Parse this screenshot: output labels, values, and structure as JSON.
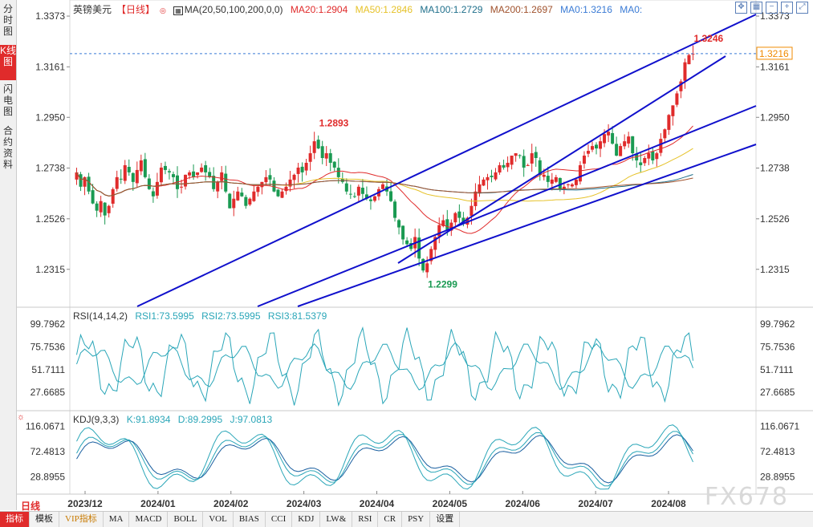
{
  "sidebar": {
    "tabs": [
      {
        "label": "分时图",
        "active": false
      },
      {
        "label": "K线图",
        "active": true
      },
      {
        "label": "闪电图",
        "active": false
      },
      {
        "label": "合约资料",
        "active": false
      }
    ]
  },
  "header": {
    "symbol": "英镑美元",
    "period": "【日线】",
    "ma_label": "MA(20,50,100,200,0,0)",
    "ma20": "MA20:1.2904",
    "ma50": "MA50:1.2846",
    "ma100": "MA100:1.2729",
    "ma200": "MA200:1.2697",
    "ma0a": "MA0:1.3216",
    "ma0b": "MA0:"
  },
  "colors": {
    "up": "#e02b2b",
    "down": "#1a9a52",
    "ma20": "#e02b2b",
    "ma50": "#e6c229",
    "ma100": "#1f6f8b",
    "ma200": "#a0522d",
    "trend": "#1010cc",
    "price_tag": "#f08a00"
  },
  "icons": [
    "move-icon",
    "grid-icon",
    "zoom-out-icon",
    "zoom-in-icon",
    "fit-icon"
  ],
  "chart_data": [
    {
      "type": "candlestick",
      "title": "英镑美元 日线",
      "y_ticks": [
        "1.3373",
        "1.3161",
        "1.2950",
        "1.2738",
        "1.2526",
        "1.2315"
      ],
      "ylim": [
        1.216,
        1.34
      ],
      "x_ticks": [
        "2023/12",
        "2024/01",
        "2024/02",
        "2024/03",
        "2024/04",
        "2024/05",
        "2024/06",
        "2024/07",
        "2024/08"
      ],
      "annotations": [
        {
          "text": "1.2893",
          "value": 1.2893,
          "kind": "high"
        },
        {
          "text": "1.2299",
          "value": 1.2299,
          "kind": "low"
        },
        {
          "text": "1.3246",
          "value": 1.3246,
          "kind": "high"
        }
      ],
      "current_price": "1.3216",
      "closes": [
        1.272,
        1.266,
        1.27,
        1.264,
        1.259,
        1.256,
        1.26,
        1.254,
        1.258,
        1.265,
        1.27,
        1.269,
        1.275,
        1.272,
        1.268,
        1.273,
        1.277,
        1.27,
        1.265,
        1.262,
        1.268,
        1.274,
        1.273,
        1.272,
        1.27,
        1.265,
        1.266,
        1.271,
        1.272,
        1.27,
        1.272,
        1.274,
        1.272,
        1.27,
        1.265,
        1.268,
        1.272,
        1.264,
        1.257,
        1.261,
        1.264,
        1.262,
        1.258,
        1.261,
        1.264,
        1.266,
        1.268,
        1.27,
        1.269,
        1.264,
        1.262,
        1.264,
        1.266,
        1.269,
        1.271,
        1.274,
        1.272,
        1.276,
        1.28,
        1.285,
        1.282,
        1.278,
        1.28,
        1.276,
        1.274,
        1.27,
        1.268,
        1.264,
        1.263,
        1.262,
        1.266,
        1.263,
        1.261,
        1.26,
        1.262,
        1.265,
        1.267,
        1.264,
        1.26,
        1.253,
        1.249,
        1.244,
        1.242,
        1.24,
        1.245,
        1.236,
        1.231,
        1.234,
        1.24,
        1.245,
        1.25,
        1.252,
        1.248,
        1.251,
        1.255,
        1.253,
        1.251,
        1.253,
        1.258,
        1.264,
        1.267,
        1.269,
        1.27,
        1.27,
        1.272,
        1.275,
        1.274,
        1.276,
        1.279,
        1.28,
        1.279,
        1.274,
        1.275,
        1.28,
        1.278,
        1.271,
        1.271,
        1.268,
        1.269,
        1.27,
        1.265,
        1.266,
        1.267,
        1.267,
        1.269,
        1.275,
        1.279,
        1.281,
        1.283,
        1.282,
        1.285,
        1.288,
        1.289,
        1.284,
        1.279,
        1.283,
        1.285,
        1.287,
        1.28,
        1.277,
        1.275,
        1.278,
        1.28,
        1.277,
        1.28,
        1.286,
        1.29,
        1.296,
        1.3,
        1.305,
        1.31,
        1.318,
        1.321,
        1.3216
      ],
      "series": [
        {
          "name": "MA20",
          "value": 1.2904
        },
        {
          "name": "MA50",
          "value": 1.2846
        },
        {
          "name": "MA100",
          "value": 1.2729
        },
        {
          "name": "MA200",
          "value": 1.2697
        }
      ]
    },
    {
      "type": "line",
      "title": "RSI(14,14,2)",
      "series": [
        {
          "name": "RSI1",
          "last": 73.5995
        },
        {
          "name": "RSI2",
          "last": 73.5995
        },
        {
          "name": "RSI3",
          "last": 81.5379
        }
      ],
      "y_ticks": [
        "99.7962",
        "75.7536",
        "51.7111",
        "27.6685"
      ],
      "ylim": [
        10,
        105
      ]
    },
    {
      "type": "line",
      "title": "KDJ(9,3,3)",
      "series": [
        {
          "name": "K",
          "last": 91.8934
        },
        {
          "name": "D",
          "last": 89.2995
        },
        {
          "name": "J",
          "last": 97.0813
        }
      ],
      "y_ticks": [
        "116.0671",
        "72.4813",
        "28.8955"
      ],
      "ylim": [
        5,
        125
      ]
    }
  ],
  "rsi_legend": {
    "title": "RSI(14,14,2)",
    "rsi1": "RSI1:73.5995",
    "rsi2": "RSI2:73.5995",
    "rsi3": "RSI3:81.5379"
  },
  "kdj_legend": {
    "title": "KDJ(9,3,3)",
    "k": "K:91.8934",
    "d": "D:89.2995",
    "j": "J:97.0813"
  },
  "period_tag": "日线",
  "watermark": "FX678",
  "bottom_bar": [
    "指标",
    "模板",
    "VIP指标",
    "MA",
    "MACD",
    "BOLL",
    "VOL",
    "BIAS",
    "CCI",
    "KDJ",
    "LW&",
    "RSI",
    "CR",
    "PSY",
    "设置"
  ]
}
